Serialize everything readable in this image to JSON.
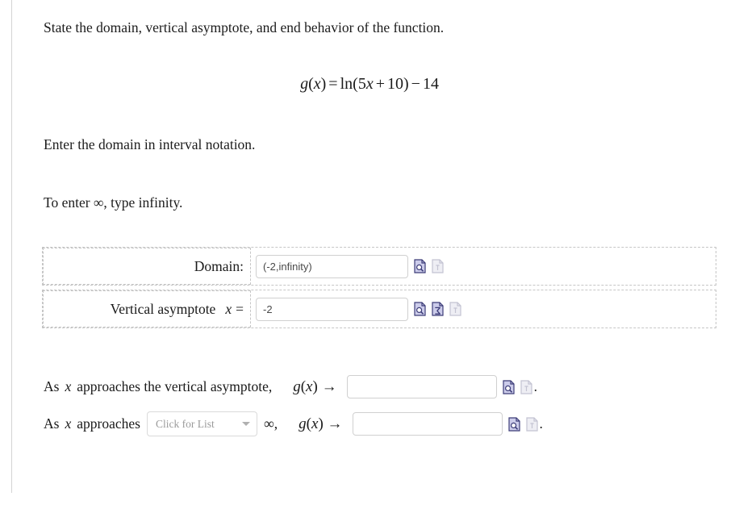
{
  "question": {
    "title": "State the domain, vertical asymptote, and end behavior of the function.",
    "instruction_domain": "Enter the domain in interval notation.",
    "instruction_infinity": "To enter ∞, type infinity."
  },
  "formula": {
    "function_name": "g",
    "variable": "x",
    "lhs_open": "(",
    "lhs_close": ")",
    "equals": "=",
    "ln": "ln",
    "group_open": "(",
    "coefficient": "5",
    "plus": "+",
    "constant": "10",
    "group_close": ")",
    "minus": "−",
    "subtract_value": "14",
    "full_text": "g(x) = ln(5x + 10) − 14"
  },
  "answers": {
    "domain": {
      "label": "Domain:",
      "value": "(-2,infinity)",
      "placeholder": ""
    },
    "vertical_asymptote": {
      "label": "Vertical asymptote",
      "variable": "x",
      "equals": "=",
      "value": "-2",
      "placeholder": ""
    }
  },
  "end_behavior": {
    "row1": {
      "lead_as": "As",
      "variable": "x",
      "text": "approaches the vertical asymptote,",
      "expr_fn": "g",
      "expr_open": "(",
      "expr_var": "x",
      "expr_close": ")",
      "arrow": "→",
      "value": "",
      "placeholder": "",
      "period": "."
    },
    "row2": {
      "lead_as": "As",
      "variable": "x",
      "text": "approaches",
      "select_placeholder": "Click for List",
      "infinity": "∞",
      "comma": ",",
      "expr_fn": "g",
      "expr_open": "(",
      "expr_var": "x",
      "expr_close": ")",
      "arrow": "→",
      "value": "",
      "placeholder": "",
      "period": "."
    }
  },
  "icons": {
    "preview": "document-magnifier-icon",
    "symbolic": "document-sigma-icon",
    "disabled": "document-disabled-icon",
    "sigma_glyph": "Σ",
    "caret": "chevron-down-icon"
  },
  "colors": {
    "icon_fill": "#ccccea",
    "icon_stroke": "#3c3c78",
    "icon_disabled_fill": "#e4e4ef",
    "icon_disabled_stroke": "#b9b9cc",
    "input_border": "#d0d0d0",
    "dashed_border": "#c6c6c6",
    "text": "#1c1c1c",
    "placeholder": "#9a9a9a",
    "rule": "#d4d4d4"
  }
}
